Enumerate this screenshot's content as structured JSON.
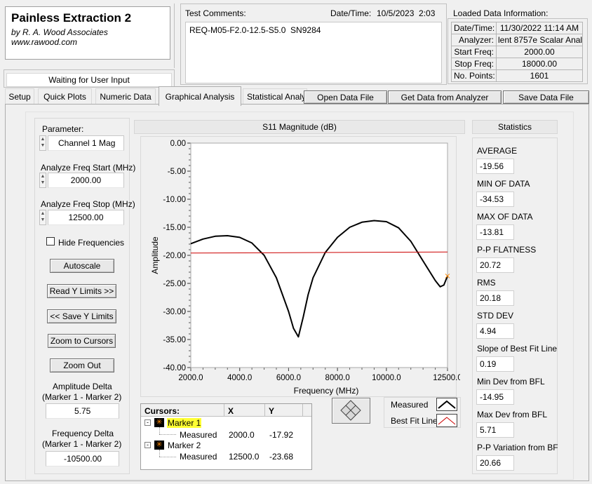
{
  "app": {
    "title": "Painless Extraction 2",
    "author": "by R. A. Wood Associates",
    "website": "www.rawood.com",
    "status": "Waiting for User Input"
  },
  "comments": {
    "label": "Test Comments:",
    "text": "REQ-M05-F2.0-12.5-S5.0  SN9284",
    "datetime_label": "Date/Time:",
    "datetime_value": "10/5/2023  2:03"
  },
  "loaded_info": {
    "title": "Loaded Data Information:",
    "rows": [
      {
        "label": "Date/Time:",
        "value": "11/30/2022 11:14 AM"
      },
      {
        "label": "Analyzer:",
        "value": "lent 8757e Scalar Analy"
      },
      {
        "label": "Start Freq:",
        "value": "2000.00"
      },
      {
        "label": "Stop Freq:",
        "value": "18000.00"
      },
      {
        "label": "No. Points:",
        "value": "1601"
      }
    ]
  },
  "tabs": [
    "Setup",
    "Quick Plots",
    "Numeric Data",
    "Graphical Analysis",
    "Statistical Analy"
  ],
  "toolbar": {
    "open_label": "Open Data File",
    "get_label": "Get Data from Analyzer",
    "save_label": "Save Data File"
  },
  "left_panel": {
    "parameter_label": "Parameter:",
    "parameter_value": "Channel 1 Mag",
    "freq_start_label": "Analyze Freq Start (MHz)",
    "freq_start_value": "2000.00",
    "freq_stop_label": "Analyze Freq Stop (MHz)",
    "freq_stop_value": "12500.00",
    "hide_freq_label": "Hide Frequencies",
    "autoscale_label": "Autoscale",
    "read_y_label": "Read Y Limits >>",
    "save_y_label": "<< Save Y Limits",
    "zoom_cursors_label": "Zoom to Cursors",
    "zoom_out_label": "Zoom Out",
    "amp_delta_label1": "Amplitude Delta",
    "amp_delta_label2": "(Marker 1 - Marker 2)",
    "amp_delta_value": "5.75",
    "freq_delta_label1": "Frequency Delta",
    "freq_delta_label2": "(Marker 1 - Marker 2)",
    "freq_delta_value": "-10500.00"
  },
  "graph": {
    "title": "S11 Magnitude (dB)",
    "xlabel": "Frequency (MHz)",
    "ylabel": "Amplitude",
    "x_ticks": [
      "2000.0",
      "4000.0",
      "6000.0",
      "8000.0",
      "10000.0",
      "12500.0"
    ],
    "y_ticks": [
      "0.00",
      "-5.00",
      "-10.00",
      "-15.00",
      "-20.00",
      "-25.00",
      "-30.00",
      "-35.00",
      "-40.00"
    ]
  },
  "cursors": {
    "header": "Cursors:",
    "x_header": "X",
    "y_header": "Y",
    "marker1_name": "Marker 1",
    "marker1_sub": "Measured",
    "marker1_x": "2000.0",
    "marker1_y": "-17.92",
    "marker2_name": "Marker 2",
    "marker2_sub": "Measured",
    "marker2_x": "12500.0",
    "marker2_y": "-23.68",
    "marker1_color": "#ffff33"
  },
  "legend": {
    "measured_label": "Measured",
    "bestfit_label": "Best Fit Line",
    "measured_color": "#000000",
    "bestfit_color": "#cc0000"
  },
  "statistics": {
    "title": "Statistics",
    "items": [
      {
        "label": "AVERAGE",
        "value": "-19.56"
      },
      {
        "label": "MIN OF DATA",
        "value": "-34.53"
      },
      {
        "label": "MAX OF DATA",
        "value": "-13.81"
      },
      {
        "label": "P-P FLATNESS",
        "value": "20.72"
      },
      {
        "label": "RMS",
        "value": "20.18"
      },
      {
        "label": "STD DEV",
        "value": "4.94"
      },
      {
        "label": "Slope of Best Fit Line",
        "value": "0.19"
      },
      {
        "label": "Min Dev from BFL",
        "value": "-14.95"
      },
      {
        "label": "Max Dev from BFL",
        "value": "5.71"
      },
      {
        "label": "P-P Variation from BF",
        "value": "20.66"
      }
    ]
  },
  "chart_data": {
    "type": "line",
    "title": "S11 Magnitude (dB)",
    "xlabel": "Frequency (MHz)",
    "ylabel": "Amplitude",
    "xlim": [
      2000,
      12500
    ],
    "ylim": [
      -40,
      0
    ],
    "grid": false,
    "series": [
      {
        "name": "Measured",
        "x": [
          2000,
          2500,
          3000,
          3500,
          4000,
          4500,
          5000,
          5500,
          6000,
          6200,
          6400,
          6600,
          6800,
          7000,
          7500,
          8000,
          8500,
          9000,
          9500,
          10000,
          10500,
          11000,
          11500,
          12000,
          12200,
          12350,
          12500
        ],
        "y": [
          -17.92,
          -17.1,
          -16.6,
          -16.5,
          -16.8,
          -17.8,
          -20.0,
          -24.0,
          -30.0,
          -33.0,
          -34.53,
          -31.0,
          -27.0,
          -24.0,
          -19.5,
          -16.8,
          -15.0,
          -14.1,
          -13.81,
          -14.0,
          -15.1,
          -17.5,
          -21.0,
          -24.5,
          -25.6,
          -25.3,
          -23.68
        ]
      },
      {
        "name": "Best Fit Line",
        "x": [
          2000,
          12500
        ],
        "y": [
          -19.6,
          -19.4
        ]
      }
    ]
  }
}
